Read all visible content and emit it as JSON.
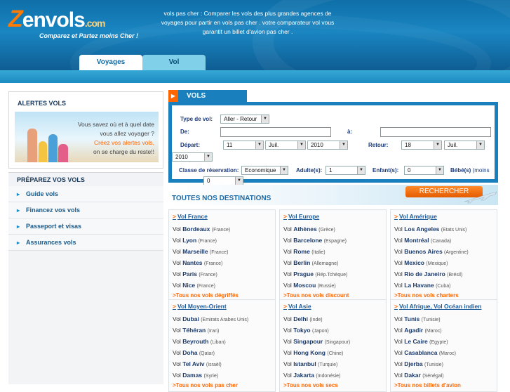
{
  "header": {
    "logo_z": "Z",
    "logo_main": "envols",
    "logo_com": ".com",
    "logo_tagline": "Comparez et Partez moins Cher !",
    "intro_text": "vols pas cher : Comparer les vols des plus grandes agences de voyages pour partir en vols pas cher . votre comparateur vol vous garantit un billet d'avion pas cher ."
  },
  "tabs": [
    {
      "label": "Voyages",
      "active": true
    },
    {
      "label": "Vol",
      "active": false
    }
  ],
  "alerts": {
    "title": "ALERTES VOLS",
    "line1": "Vous savez où et à quel date",
    "line2": "vous allez voyager ?",
    "line3": "Créez vos alertes vols,",
    "line4": "on se charge du reste!!"
  },
  "prepare": {
    "title": "PRÉPAREZ VOS VOLS",
    "items": [
      {
        "label": "Guide vols"
      },
      {
        "label": "Financez vos vols"
      },
      {
        "label": "Passeport et visas"
      },
      {
        "label": "Assurances vols"
      }
    ]
  },
  "search": {
    "header": "VOLS",
    "trip_type_label": "Type de vol:",
    "trip_type_value": "Aller - Retour",
    "from_label": "De:",
    "to_label": "à:",
    "depart_label": "Départ:",
    "depart_day": "11",
    "depart_month": "Juil.",
    "depart_year": "2010",
    "return_label": "Retour:",
    "return_day": "18",
    "return_month": "Juil.",
    "return_year": "2010",
    "class_label": "Classe de réservation:",
    "class_value": "Economique",
    "adults_label": "Adulte(s):",
    "adults_value": "1",
    "children_label": "Enfant(s):",
    "children_value": "0",
    "babies_label": "Bébé(s)",
    "babies_note": "(moins",
    "babies_value": "0",
    "search_button": "RECHERCHER",
    "destinations_title": "TOUTES NOS DESTINATIONS"
  },
  "destinations": [
    {
      "title": "Vol France",
      "rows": [
        {
          "pre": "Vol ",
          "city": "Bordeaux",
          "country": "(France)"
        },
        {
          "pre": "Vol ",
          "city": "Lyon",
          "country": "(France)"
        },
        {
          "pre": "Vol ",
          "city": "Marseille",
          "country": "(France)"
        },
        {
          "pre": "Vol ",
          "city": "Nantes",
          "country": "(France)"
        },
        {
          "pre": "Vol ",
          "city": "Paris",
          "country": "(France)"
        },
        {
          "pre": "Vol ",
          "city": "Nice",
          "country": "(France)"
        }
      ],
      "more": ">Tous nos vols dégriffés"
    },
    {
      "title": "Vol Europe",
      "rows": [
        {
          "pre": "Vol ",
          "city": "Athènes",
          "country": "(Grèce)"
        },
        {
          "pre": "Vol ",
          "city": "Barcelone",
          "country": "(Espagne)"
        },
        {
          "pre": "Vol ",
          "city": "Rome",
          "country": "(Italie)"
        },
        {
          "pre": "Vol ",
          "city": "Berlin",
          "country": "(Allemagne)"
        },
        {
          "pre": "Vol ",
          "city": "Prague",
          "country": "(Rép.Tchèque)"
        },
        {
          "pre": "Vol ",
          "city": "Moscou",
          "country": "(Russie)"
        }
      ],
      "more": ">Tous nos vols discount"
    },
    {
      "title": "Vol Amérique",
      "rows": [
        {
          "pre": "Vol ",
          "city": "Los Angeles",
          "country": "(Etats Unis)"
        },
        {
          "pre": "Vol ",
          "city": "Montréal",
          "country": "(Canada)"
        },
        {
          "pre": "Vol ",
          "city": "Buenos Aires",
          "country": "(Argentine)"
        },
        {
          "pre": "Vol ",
          "city": "Mexico",
          "country": "(Mexique)"
        },
        {
          "pre": "Vol ",
          "city": "Rio de Janeiro",
          "country": "(Brésil)"
        },
        {
          "pre": "Vol ",
          "city": "La Havane",
          "country": "(Cuba)"
        }
      ],
      "more": ">Tous nos vols charters"
    },
    {
      "title": "Vol Moyen-Orient",
      "rows": [
        {
          "pre": "Vol ",
          "city": "Dubai",
          "country": "(Emirats Arabes Unis)"
        },
        {
          "pre": "Vol ",
          "city": "Téhéran",
          "country": "(Iran)"
        },
        {
          "pre": "Vol ",
          "city": "Beyrouth",
          "country": "(Liban)"
        },
        {
          "pre": "Vol ",
          "city": "Doha",
          "country": "(Qatar)"
        },
        {
          "pre": "Vol ",
          "city": "Tel Aviv",
          "country": "(Israël)"
        },
        {
          "pre": "Vol ",
          "city": "Damas",
          "country": "(Syrie)"
        }
      ],
      "more": ">Tous nos vols pas cher"
    },
    {
      "title": "Vol Asie",
      "rows": [
        {
          "pre": "Vol ",
          "city": "Delhi",
          "country": "(Inde)"
        },
        {
          "pre": "Vol ",
          "city": "Tokyo",
          "country": "(Japon)"
        },
        {
          "pre": "Vol ",
          "city": "Singapour",
          "country": "(Singapour)"
        },
        {
          "pre": "Vol ",
          "city": "Hong Kong",
          "country": "(Chine)"
        },
        {
          "pre": "Vol ",
          "city": "Istanbul",
          "country": "(Turquie)"
        },
        {
          "pre": "Vol ",
          "city": "Jakarta",
          "country": "(Indonésie)"
        }
      ],
      "more": ">Tous nos vols secs"
    },
    {
      "title": "Vol Afrique, Vol Océan indien",
      "rows": [
        {
          "pre": "Vol ",
          "city": "Tunis",
          "country": "(Tunisie)"
        },
        {
          "pre": "Vol ",
          "city": "Agadir",
          "country": "(Maroc)"
        },
        {
          "pre": "Vol ",
          "city": "Le Caire",
          "country": "(Egypte)"
        },
        {
          "pre": "Vol ",
          "city": "Casablanca",
          "country": "(Maroc)"
        },
        {
          "pre": "Vol ",
          "city": "Djerba",
          "country": "(Tunisie)"
        },
        {
          "pre": "Vol ",
          "city": "Dakar",
          "country": "(Sénégal)"
        }
      ],
      "more": ">Tous nos billets d'avion"
    }
  ],
  "colors": {
    "brand_blue": "#1a7fbd",
    "accent_orange": "#ff6600",
    "nav_tab_inactive": "#7fd0e8"
  }
}
